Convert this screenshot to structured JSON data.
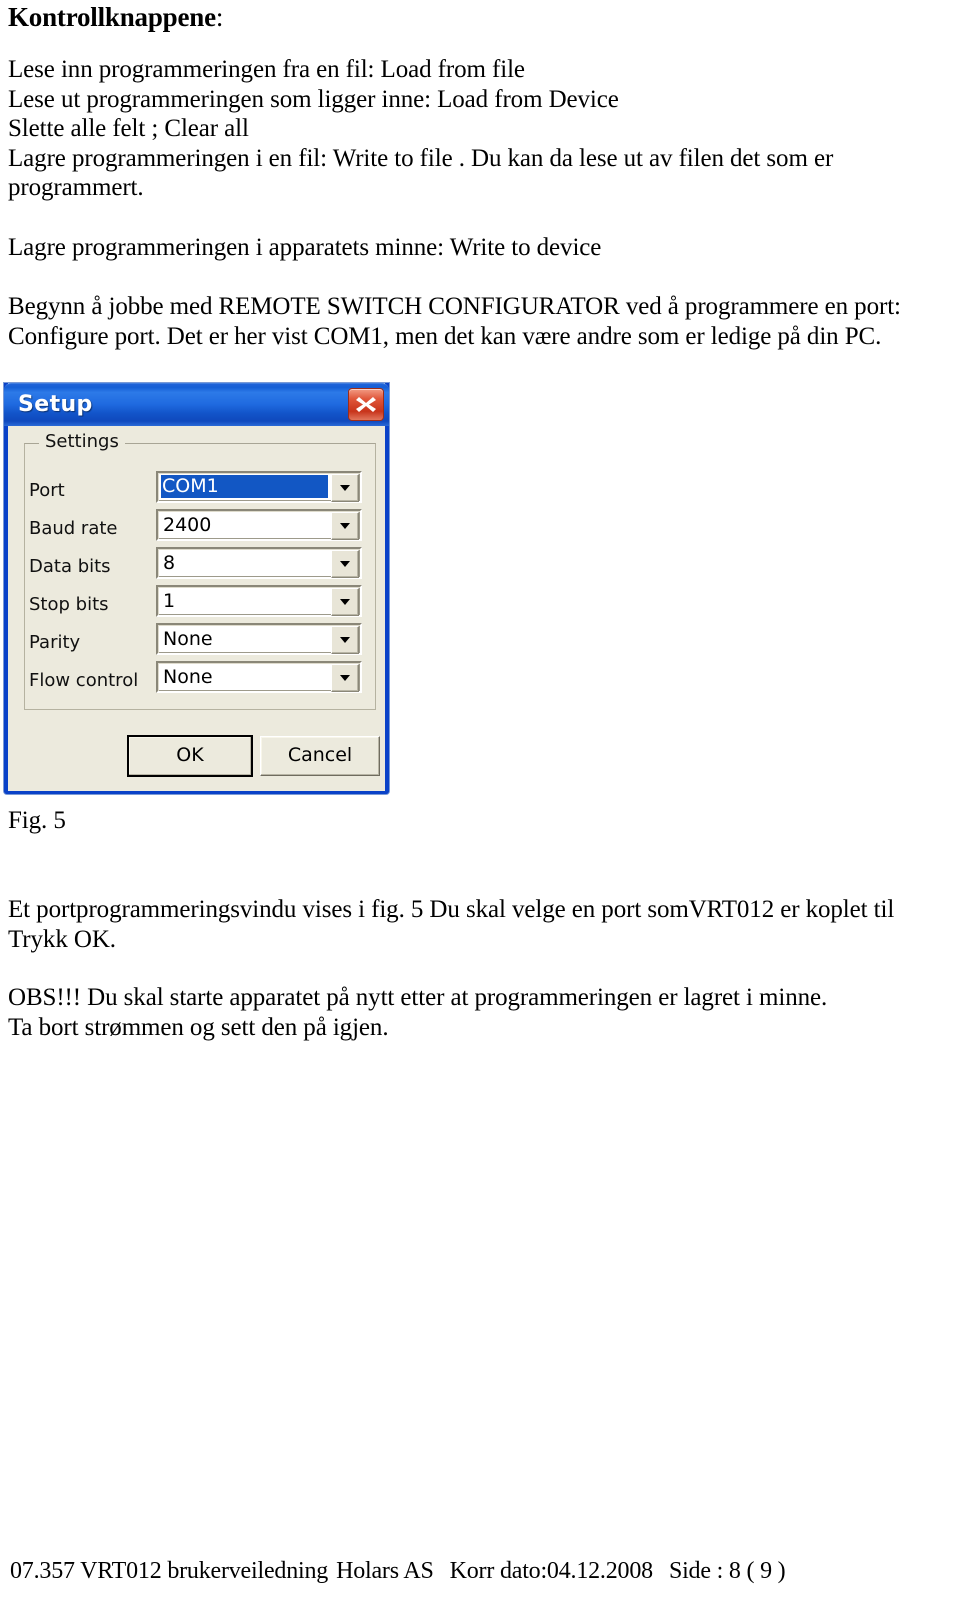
{
  "document": {
    "heading": "Kontrollknappene",
    "heading_colon": ":",
    "paragraphs": {
      "p1_line1": "Lese inn programmeringen fra en fil: Load from file",
      "p1_line2": "Lese ut programmeringen som ligger inne: Load from Device",
      "p1_line3": "Slette alle felt ; Clear all",
      "p1_line4": "Lagre programmeringen i en fil: Write to file . Du kan da lese ut av filen det som er",
      "p1_line5": "programmert.",
      "p2": "Lagre programmeringen i apparatets minne: Write to device",
      "p3_line1": "Begynn å jobbe med REMOTE SWITCH CONFIGURATOR ved å programmere en port:",
      "p3_line2": "Configure port. Det er her vist COM1, men det kan være andre som er ledige på din PC.",
      "fig_caption": "Fig. 5",
      "p4_line1": "Et portprogrammeringsvindu vises i fig. 5 Du skal velge en port somVRT012 er koplet til",
      "p4_line2": "Trykk OK.",
      "p5_line1": "OBS!!! Du skal starte apparatet på nytt etter at programmeringen er lagret i minne.",
      "p5_line2": "Ta bort strømmen og sett den på igjen."
    }
  },
  "footer": {
    "doc_number": "07.357 VRT012 brukerveiledning",
    "company": "Holars AS",
    "revision": "Korr dato:04.12.2008",
    "page": "Side : 8  ( 9 )"
  },
  "dialog": {
    "title": "Setup",
    "close_icon": "close-icon",
    "groupbox_title": "Settings",
    "fields": [
      {
        "label": "Port",
        "value": "COM1",
        "selected": true
      },
      {
        "label": "Baud rate",
        "value": "2400",
        "selected": false
      },
      {
        "label": "Data bits",
        "value": "8",
        "selected": false
      },
      {
        "label": "Stop bits",
        "value": "1",
        "selected": false
      },
      {
        "label": "Parity",
        "value": "None",
        "selected": false
      },
      {
        "label": "Flow control",
        "value": "None",
        "selected": false
      }
    ],
    "buttons": {
      "ok": "OK",
      "cancel": "Cancel"
    }
  },
  "colors": {
    "titlebar_blue": "#1f6ae0",
    "dialog_face": "#eceadd",
    "selection_blue": "#1257c4",
    "close_red": "#c8341b",
    "text": "#000000"
  }
}
